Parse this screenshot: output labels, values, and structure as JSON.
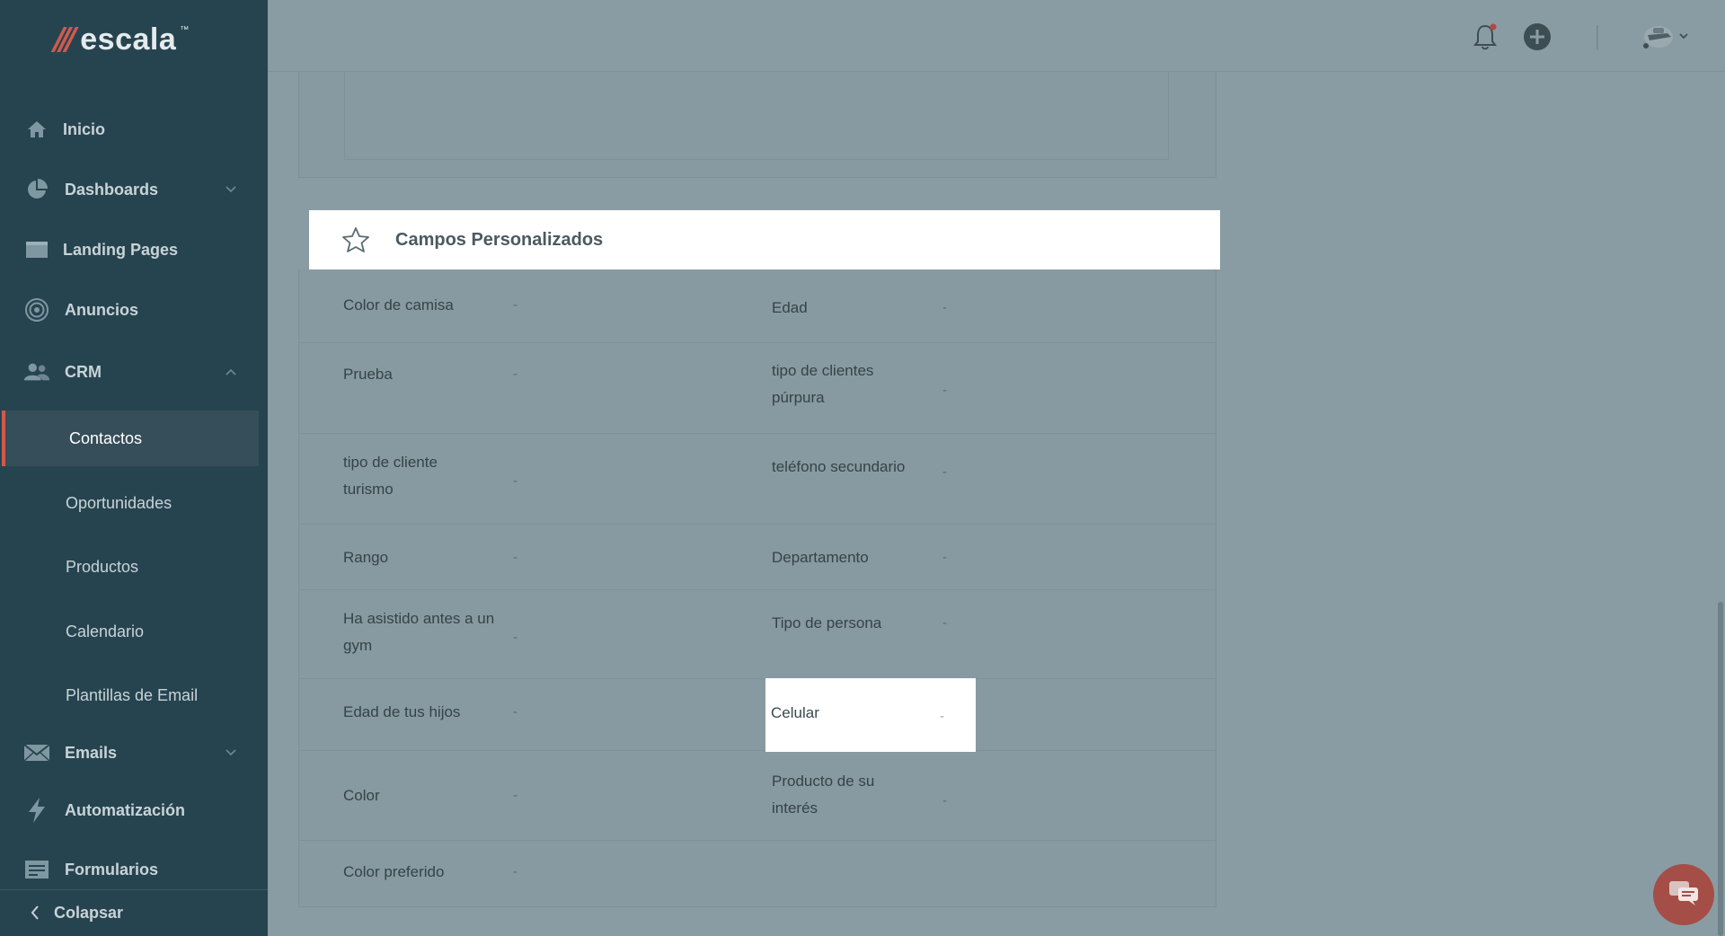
{
  "logo": {
    "slashes": "///",
    "name": "escala",
    "tm": "™"
  },
  "sidebar": {
    "items": [
      {
        "label": "Inicio",
        "icon": "home-icon"
      },
      {
        "label": "Dashboards",
        "icon": "pie-chart-icon"
      },
      {
        "label": "Landing Pages",
        "icon": "window-icon"
      },
      {
        "label": "Anuncios",
        "icon": "target-icon"
      },
      {
        "label": "CRM",
        "icon": "users-icon"
      },
      {
        "label": "Emails",
        "icon": "envelope-icon"
      },
      {
        "label": "Automatización",
        "icon": "bolt-icon"
      },
      {
        "label": "Formularios",
        "icon": "form-icon"
      }
    ],
    "crm_sub": [
      "Contactos",
      "Oportunidades",
      "Productos",
      "Calendario",
      "Plantillas de Email"
    ],
    "active_sub": "Contactos",
    "collapse_label": "Colapsar"
  },
  "topbar": {
    "icons": [
      "bell-icon",
      "plus-circle-icon",
      "avatar"
    ]
  },
  "custom_fields": {
    "title": "Campos Personalizados",
    "rows": [
      [
        {
          "label": "Color de camisa",
          "value": "-"
        },
        {
          "label": "Edad",
          "value": "-"
        }
      ],
      [
        {
          "label": "Prueba",
          "value": "-"
        },
        {
          "label": "tipo de clientes púrpura",
          "value": "-"
        }
      ],
      [
        {
          "label": "tipo de cliente turismo",
          "value": "-"
        },
        {
          "label": "teléfono secundario",
          "value": "-"
        }
      ],
      [
        {
          "label": "Rango",
          "value": "-"
        },
        {
          "label": "Departamento",
          "value": "-"
        }
      ],
      [
        {
          "label": "Ha asistido antes a un gym",
          "value": "-"
        },
        {
          "label": "Tipo de persona",
          "value": "-"
        }
      ],
      [
        {
          "label": "Edad de tus hijos",
          "value": "-"
        },
        {
          "label": "Celular",
          "value": "-"
        }
      ],
      [
        {
          "label": "Color",
          "value": "-"
        },
        {
          "label": "Producto de su interés",
          "value": "-"
        }
      ],
      [
        {
          "label": "Color preferido",
          "value": "-"
        }
      ]
    ]
  },
  "colors": {
    "sidebar": "#264450",
    "accent": "#d3594c",
    "overlay": "#8a9ca3"
  }
}
